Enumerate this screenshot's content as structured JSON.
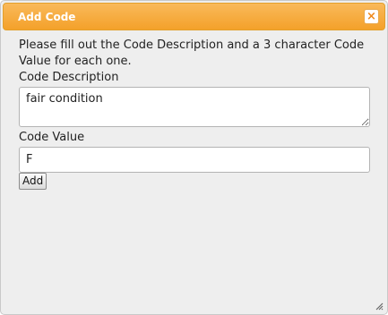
{
  "dialog": {
    "title": "Add Code",
    "close_icon": "close-icon",
    "close_glyph": "×",
    "instructions": "Please fill out the Code Description and a 3 character Code Value for each one.",
    "description_label": "Code Description",
    "description_value": "fair condition",
    "value_label": "Code Value",
    "value_value": "F",
    "add_label": "Add"
  },
  "colors": {
    "titlebar": "#f4a12a",
    "dialog_background": "#eeeeee",
    "title_text": "#ffffff"
  }
}
